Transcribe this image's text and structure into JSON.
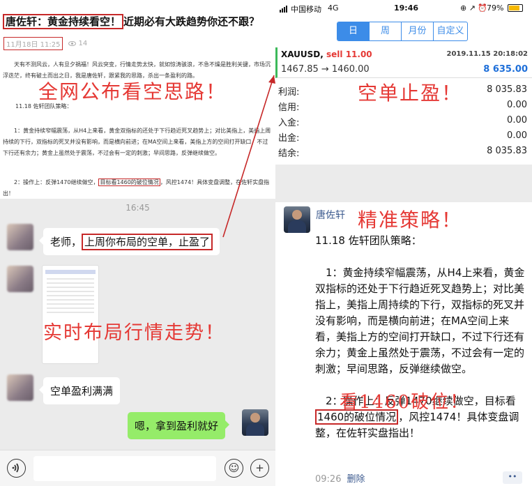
{
  "article": {
    "title_name": "唐佐轩：黄金持续看空！",
    "title_rest": "近期必有大跌趋势你还不跟？",
    "date": "11月18日 11:25",
    "views": "14",
    "para1": "天有不测风云，人有旦夕祸福！风云突变，行情走势太快，就如惊涛骇浪，不急不燥是胜利关键，市场沉浮迭茫，终有破土而出之日，我是唐佐轩，跟紧我的思路，杀出一条盈利的路。",
    "para2": "11.18 佐轩团队策略：",
    "para3": "1：黄金持续窄幅震荡，从H4上来看，黄金双指标的还处于下行趋近死叉趋势上；对比美指上，美指上周持续的下行，双指标的死叉并没有影响，而是横向前进；在MA空间上来看，美指上方的空间打开缺口，不过下行还有余力；黄金上虽然处于震荡，不过会有一定的刺激；早间思路，反弹继续做空。",
    "para4_a": "2：操作上：反弹1470继续做空，",
    "para4_hl": "目标看1460的破位情况",
    "para4_b": "，风控1474！具体变盘调整，在佐轩实盘指出！"
  },
  "overlays": {
    "left_top": "全网公布看空思路！",
    "left_mid": "实时布局行情走势！",
    "right_top": "空单止盈！",
    "right_mid": "精准策略！",
    "right_low": "看1460破位！"
  },
  "chat": {
    "time": "16:45",
    "msg1_a": "老师，",
    "msg1_hl": "上周你布局的空单，止盈了",
    "msg2": "空单盈利满满",
    "msg3": "嗯，拿到盈利就好"
  },
  "input_bar": {
    "voice_icon": "voice-icon",
    "emoji_icon": "emoji-icon",
    "plus_icon": "plus-icon",
    "emoji_glyph": "☺",
    "plus_glyph": "+"
  },
  "status_bar": {
    "carrier": "中国移动",
    "network": "4G",
    "time": "19:46",
    "icons": "⊕ ↗ ⏰",
    "battery": "79%"
  },
  "trade": {
    "tabs": [
      {
        "label": "日",
        "active": true
      },
      {
        "label": "周",
        "active": false
      },
      {
        "label": "月份",
        "active": false
      },
      {
        "label": "自定义",
        "active": false
      }
    ],
    "symbol": "XAUUSD,",
    "side": "sell 11.00",
    "datetime": "2019.11.15 20:18:02",
    "prices": "1467.85 → 1460.00",
    "profit": "8 635.00",
    "summary": [
      {
        "label": "利润:",
        "value": "8 035.83"
      },
      {
        "label": "信用:",
        "value": "0.00"
      },
      {
        "label": "入金:",
        "value": "0.00"
      },
      {
        "label": "出金:",
        "value": "0.00"
      },
      {
        "label": "结余:",
        "value": "8 035.83"
      }
    ],
    "accent_color": "#3c8ce8"
  },
  "moment": {
    "name": "唐佐轩",
    "heading": "11.18 佐轩团队策略：",
    "p1": "1：黄金持续窄幅震荡，从H4上来看，黄金双指标的还处于下行趋近死叉趋势上；对比美指上，美指上周持续的下行，双指标的死叉并没有影响，而是横向前进；在MA空间上来看，美指上方的空间打开缺口，不过下行还有余力；黄金上虽然处于震荡，不过会有一定的刺激；早间思路，反弹继续做空。",
    "p2_a": "2：操作上：反弹1470继续做空，目标看",
    "p2_hl": "1460的破位情况",
    "p2_b": "，风控1474！具体变盘调整，在佐轩实盘指出！",
    "time": "09:26",
    "delete": "删除",
    "more": "••"
  }
}
